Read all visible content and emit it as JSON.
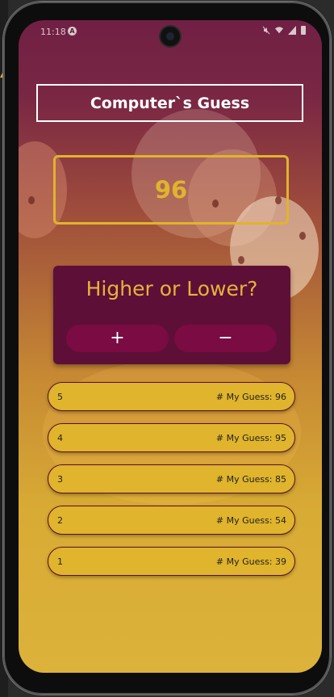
{
  "status_bar": {
    "time": "11:18",
    "app_icon": "A",
    "icons": [
      "mute-icon",
      "wifi-icon",
      "signal-icon",
      "battery-icon"
    ]
  },
  "game": {
    "title": "Computer`s Guess",
    "current_guess": "96",
    "prompt": "Higher or Lower?",
    "higher_label": "+",
    "lower_label": "−"
  },
  "guess_log": [
    {
      "round": "5",
      "text": "# My Guess: 96"
    },
    {
      "round": "4",
      "text": "# My Guess: 95"
    },
    {
      "round": "3",
      "text": "# My Guess: 85"
    },
    {
      "round": "2",
      "text": "# My Guess: 54"
    },
    {
      "round": "1",
      "text": "# My Guess: 39"
    }
  ],
  "colors": {
    "accent": "#e0b42c",
    "card": "#5e0f38",
    "button": "#7a0b43"
  }
}
